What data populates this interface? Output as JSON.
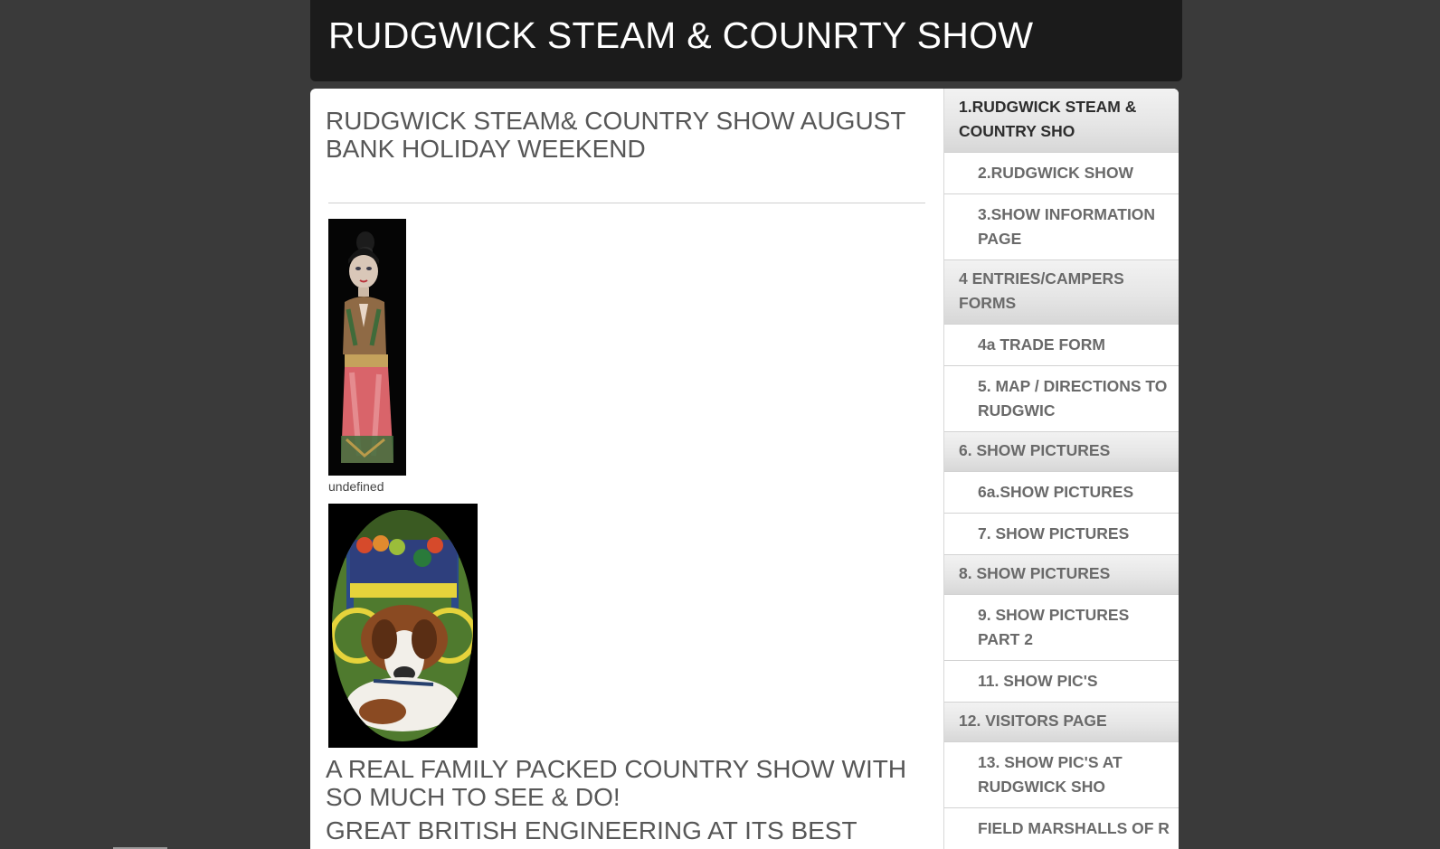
{
  "site": {
    "title": "RUDGWICK STEAM & COUNRTY SHOW"
  },
  "main": {
    "title": "RUDGWICK STEAM& COUNTRY SHOW AUGUST BANK HOLIDAY WEEKEND",
    "statue_caption": "undefined",
    "family_heading": "A REAL FAMILY PACKED COUNTRY SHOW WITH SO MUCH TO SEE & DO!",
    "engineering_heading": "GREAT BRITISH ENGINEERING AT ITS BEST"
  },
  "nav": {
    "items": [
      {
        "label": "1.RUDGWICK STEAM & COUNTRY SHO",
        "level": "top",
        "active": true
      },
      {
        "label": "2.RUDGWICK SHOW",
        "level": "sub"
      },
      {
        "label": "3.SHOW INFORMATION PAGE",
        "level": "sub"
      },
      {
        "label": "4 ENTRIES/CAMPERS FORMS",
        "level": "top"
      },
      {
        "label": "4a TRADE FORM",
        "level": "sub"
      },
      {
        "label": "5. MAP / DIRECTIONS TO RUDGWIC",
        "level": "sub"
      },
      {
        "label": "6. SHOW PICTURES",
        "level": "top"
      },
      {
        "label": "6a.SHOW PICTURES",
        "level": "sub"
      },
      {
        "label": "7. SHOW PICTURES",
        "level": "sub"
      },
      {
        "label": "8. SHOW PICTURES",
        "level": "top"
      },
      {
        "label": "9. SHOW PICTURES PART 2",
        "level": "sub"
      },
      {
        "label": "11. SHOW PIC'S",
        "level": "sub"
      },
      {
        "label": "12. VISITORS PAGE",
        "level": "top"
      },
      {
        "label": "13. SHOW PIC'S AT RUDGWICK SHO",
        "level": "sub"
      },
      {
        "label": "FIELD MARSHALLS OF R",
        "level": "sub"
      }
    ]
  },
  "colors": {
    "background": "#3a3a3a",
    "header": "#1b1b1b",
    "heading_text": "#575757",
    "nav_text": "#6a6a6a"
  }
}
